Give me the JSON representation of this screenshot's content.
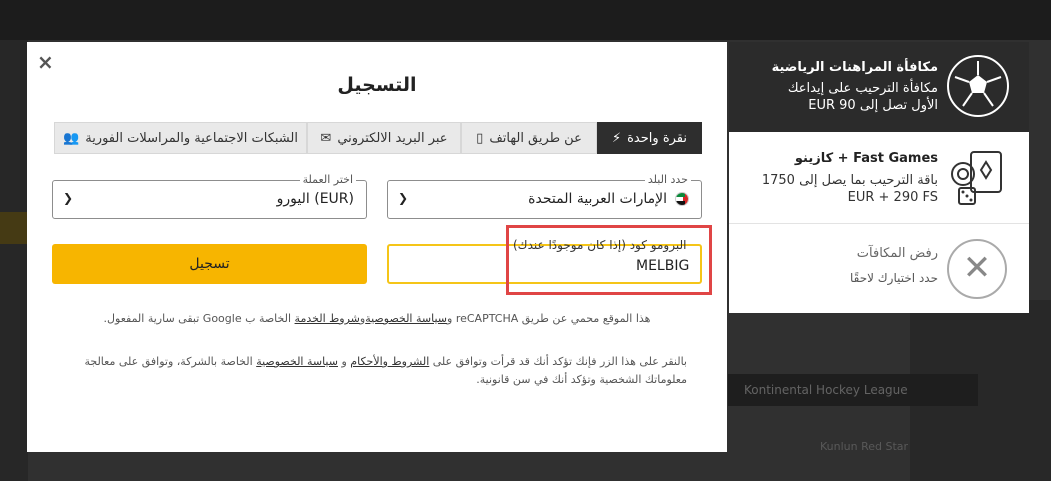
{
  "modal": {
    "title": "التسجيل",
    "close_label": "×",
    "tabs": [
      {
        "label": "نقرة واحدة",
        "icon": "bolt-icon",
        "glyph": "⚡",
        "active": true
      },
      {
        "label": "عن طريق الهاتف",
        "icon": "phone-icon",
        "glyph": "▯",
        "active": false
      },
      {
        "label": "عبر البريد الالكتروني",
        "icon": "envelope-icon",
        "glyph": "✉",
        "active": false
      },
      {
        "label": "الشبكات الاجتماعية والمراسلات الفورية",
        "icon": "users-icon",
        "glyph": "👥",
        "active": false
      }
    ],
    "country": {
      "label": "حدد البلد",
      "value": "الإمارات العربية المتحدة"
    },
    "currency": {
      "label": "اختر العملة",
      "value": "اليورو (EUR)"
    },
    "promo": {
      "label": "البرومو كود (إذا كان موجودًا عندك)",
      "value": "MELBIG"
    },
    "register_button": "تسجيل",
    "recaptcha": {
      "pre": "هذا الموقع محمي عن طريق reCAPTCHA و",
      "privacy": "سياسة الخصوصية",
      "mid": "و",
      "terms": "شروط الخدمة",
      "post": " الخاصة ب Google تبقى سارية المفعول."
    },
    "consent": {
      "pre": "بالنقر على هذا الزر فإنك تؤكد أنك قد قرأت وتوافق على ",
      "terms": "الشروط والأحكام",
      "mid": " و ",
      "privacy": "سياسة الخصوصية",
      "post": " الخاصة بالشركة، وتوافق على معالجة معلوماتك الشخصية وتؤكد أنك في سن قانونية."
    }
  },
  "bonuses": [
    {
      "title": "مكافأة المراهنات الرياضية",
      "desc1": "مكافأة الترحيب على إيداعك",
      "desc2": "الأول تصل إلى 90 EUR",
      "icon": "soccer-ball-icon"
    },
    {
      "title": "كازينو + Fast Games",
      "desc1": "باقة الترحيب بما يصل إلى 1750",
      "desc2": "EUR + 290 FS",
      "icon": "casino-cards-icon"
    },
    {
      "title": "رفض المكافآت",
      "desc1": "حدد اختيارك لاحقًا",
      "icon": "reject-icon"
    }
  ],
  "background": {
    "league": "Kontinental Hockey League",
    "team": "Kunlun Red Star"
  }
}
